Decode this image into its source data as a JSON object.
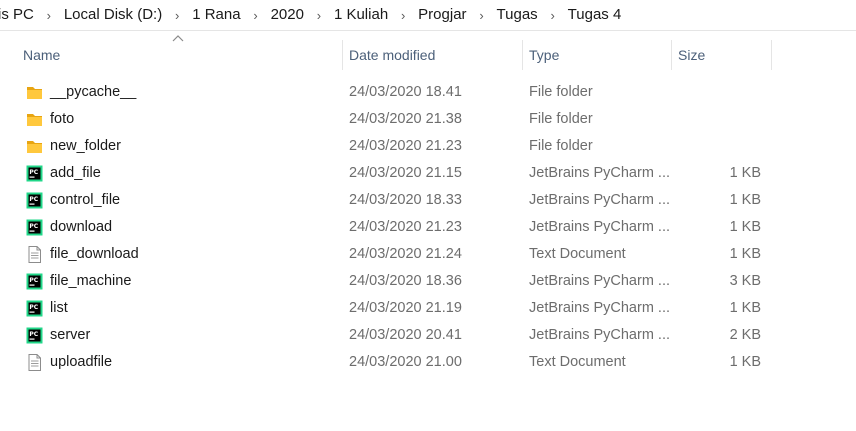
{
  "breadcrumb": [
    {
      "label": "is PC"
    },
    {
      "label": "Local Disk (D:)"
    },
    {
      "label": "1 Rana"
    },
    {
      "label": "2020"
    },
    {
      "label": "1 Kuliah"
    },
    {
      "label": "Progjar"
    },
    {
      "label": "Tugas"
    },
    {
      "label": "Tugas 4"
    }
  ],
  "columns": {
    "name": "Name",
    "date": "Date modified",
    "type": "Type",
    "size": "Size"
  },
  "sort": {
    "column": "name",
    "direction": "ascending"
  },
  "files": [
    {
      "name": "__pycache__",
      "date": "24/03/2020 18.41",
      "type": "File folder",
      "size": "",
      "icon": "folder-icon"
    },
    {
      "name": "foto",
      "date": "24/03/2020 21.38",
      "type": "File folder",
      "size": "",
      "icon": "folder-icon"
    },
    {
      "name": "new_folder",
      "date": "24/03/2020 21.23",
      "type": "File folder",
      "size": "",
      "icon": "folder-icon"
    },
    {
      "name": "add_file",
      "date": "24/03/2020 21.15",
      "type": "JetBrains PyCharm ...",
      "size": "1 KB",
      "icon": "pycharm-file-icon"
    },
    {
      "name": "control_file",
      "date": "24/03/2020 18.33",
      "type": "JetBrains PyCharm ...",
      "size": "1 KB",
      "icon": "pycharm-file-icon"
    },
    {
      "name": "download",
      "date": "24/03/2020 21.23",
      "type": "JetBrains PyCharm ...",
      "size": "1 KB",
      "icon": "pycharm-file-icon"
    },
    {
      "name": "file_download",
      "date": "24/03/2020 21.24",
      "type": "Text Document",
      "size": "1 KB",
      "icon": "text-document-icon"
    },
    {
      "name": "file_machine",
      "date": "24/03/2020 18.36",
      "type": "JetBrains PyCharm ...",
      "size": "3 KB",
      "icon": "pycharm-file-icon"
    },
    {
      "name": "list",
      "date": "24/03/2020 21.19",
      "type": "JetBrains PyCharm ...",
      "size": "1 KB",
      "icon": "pycharm-file-icon"
    },
    {
      "name": "server",
      "date": "24/03/2020 20.41",
      "type": "JetBrains PyCharm ...",
      "size": "2 KB",
      "icon": "pycharm-file-icon"
    },
    {
      "name": "uploadfile",
      "date": "24/03/2020 21.00",
      "type": "Text Document",
      "size": "1 KB",
      "icon": "text-document-icon"
    }
  ],
  "colors": {
    "folder": "#ffc83d",
    "folder_back": "#e8a512",
    "pycharm_green": "#21d789",
    "pycharm_dark": "#000000",
    "header_text": "#4c607a",
    "secondary_text": "#6d6d6d"
  }
}
